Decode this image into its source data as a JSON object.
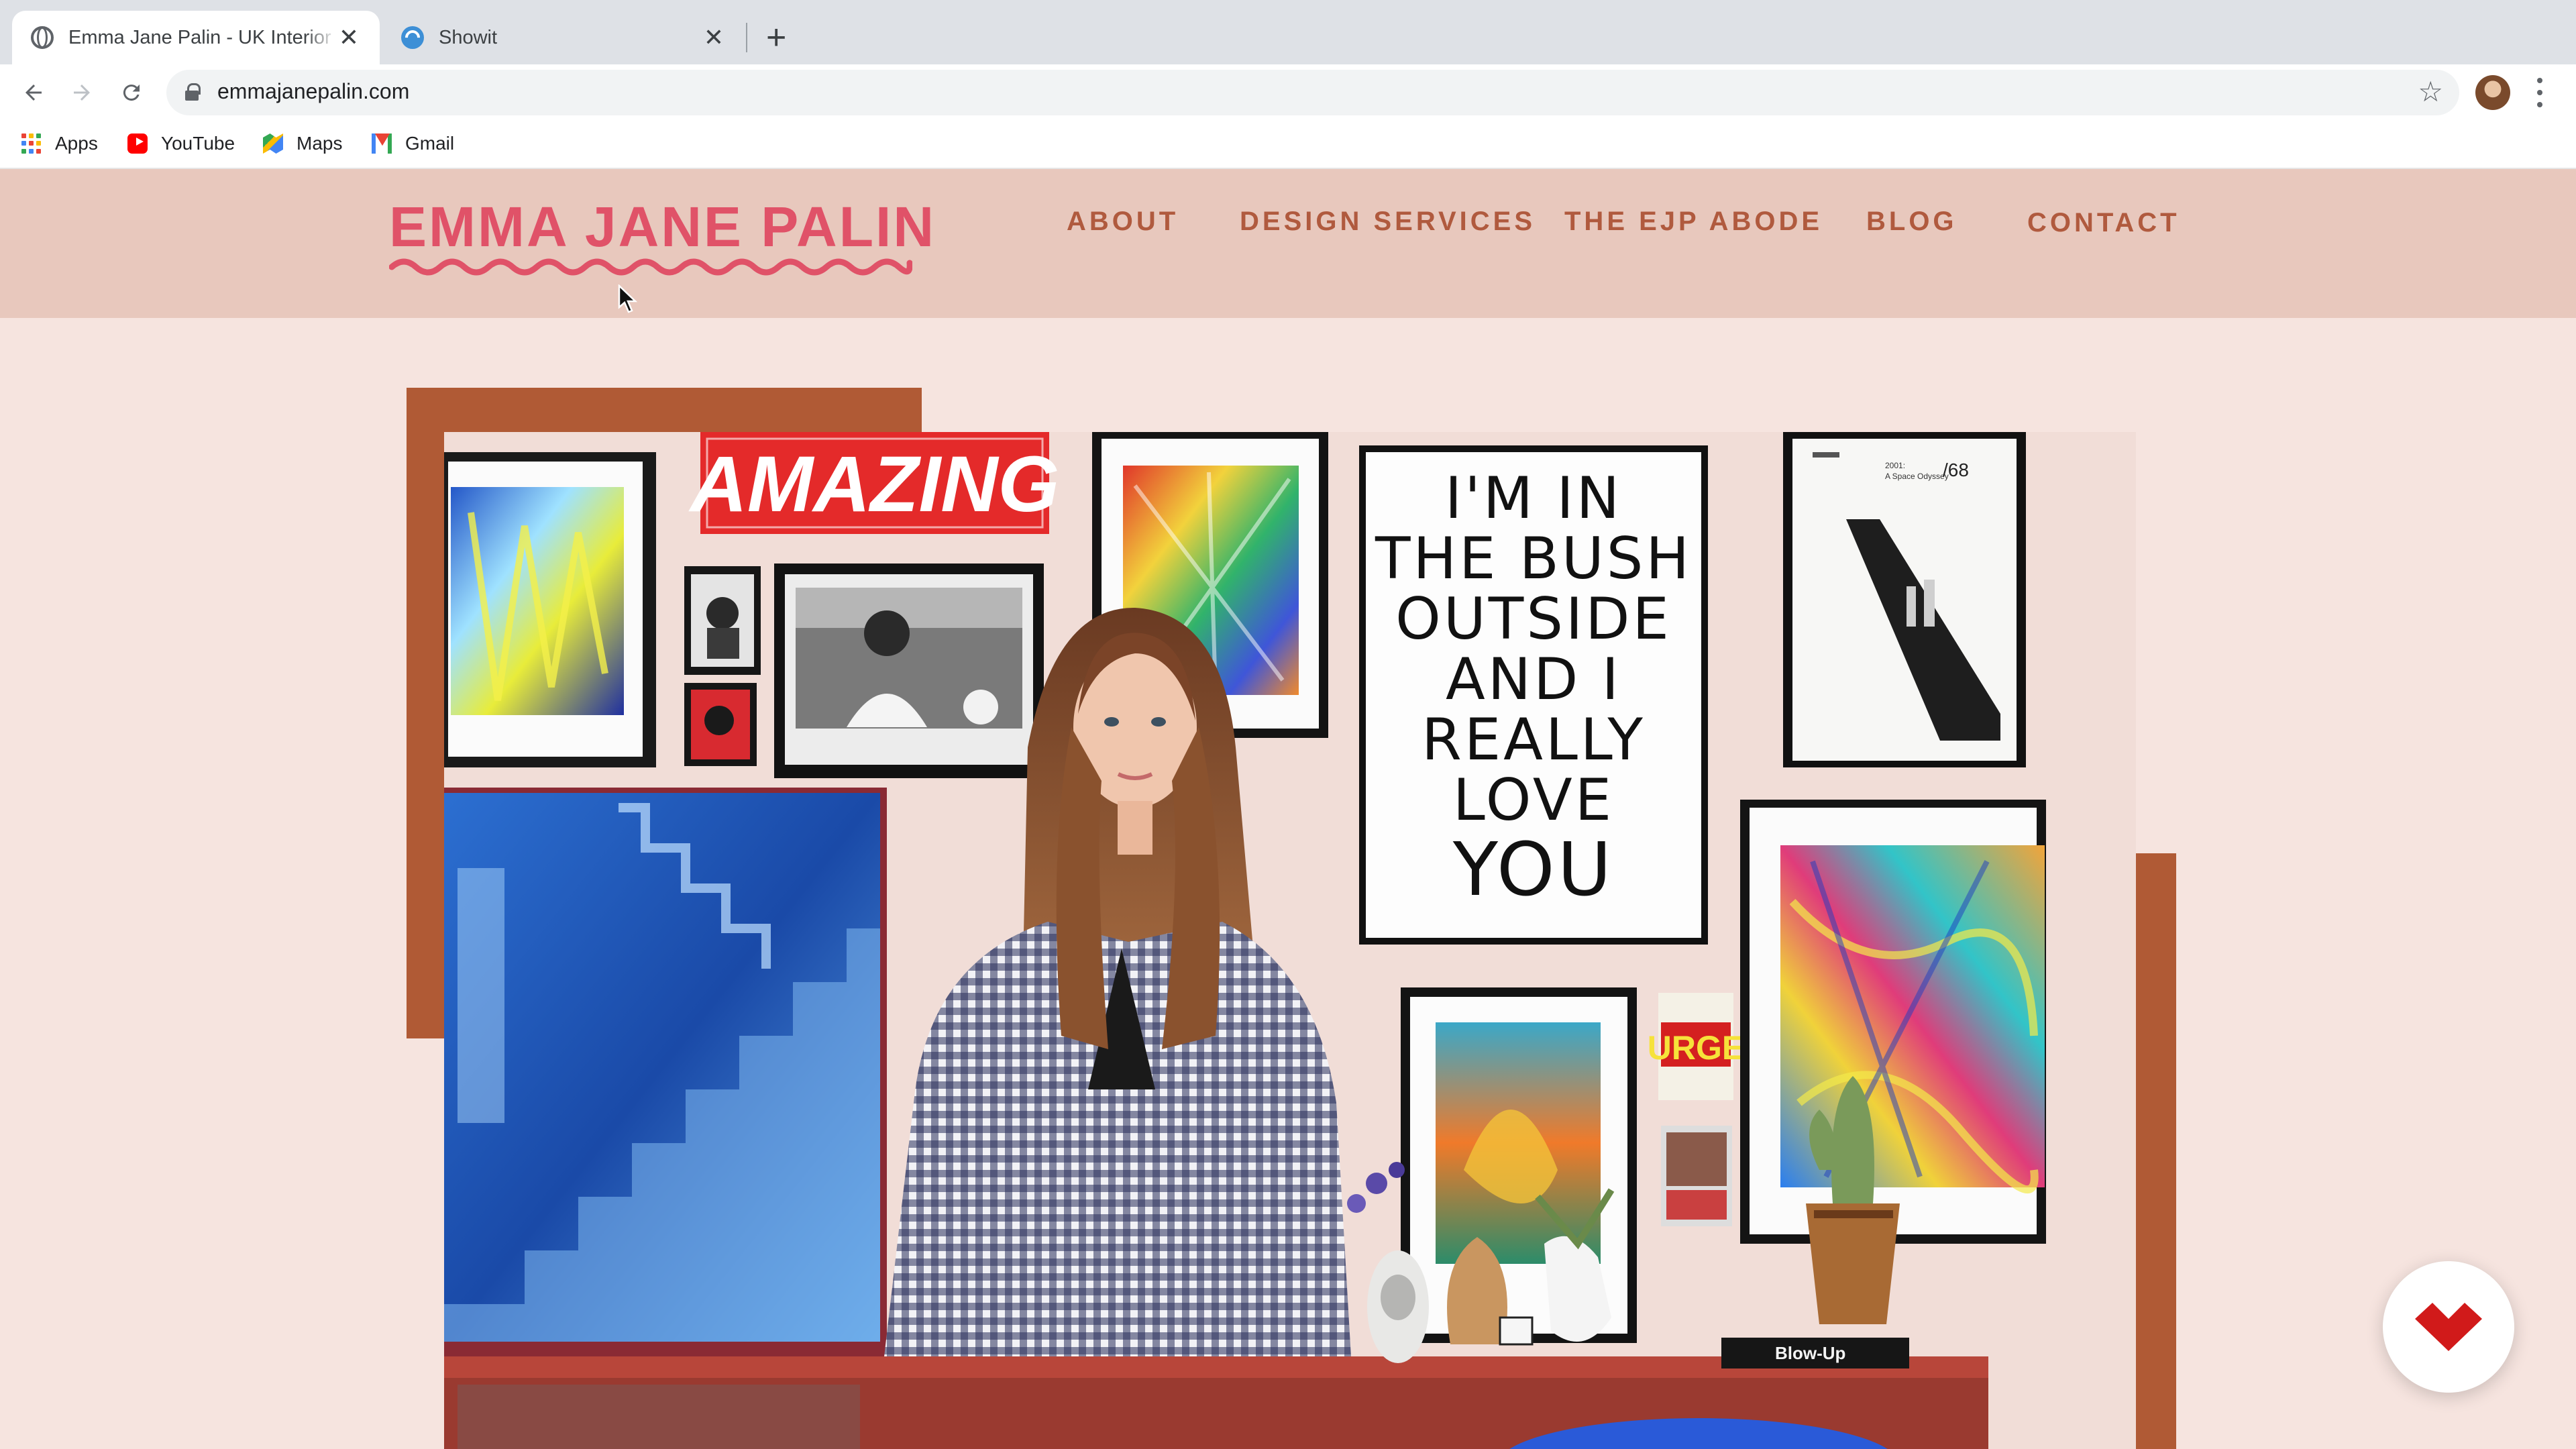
{
  "browser": {
    "tabs": [
      {
        "title": "Emma Jane Palin - UK Interior D",
        "favicon": "globe-icon",
        "active": true
      },
      {
        "title": "Showit",
        "favicon": "showit-icon",
        "active": false
      }
    ],
    "new_tab_label": "+",
    "close_glyph": "✕",
    "address": {
      "url": "emmajanepalin.com"
    },
    "bookmarks": [
      {
        "label": "Apps",
        "icon": "apps-grid-icon"
      },
      {
        "label": "YouTube",
        "icon": "youtube-icon"
      },
      {
        "label": "Maps",
        "icon": "maps-icon"
      },
      {
        "label": "Gmail",
        "icon": "gmail-icon"
      }
    ]
  },
  "site": {
    "logo": "EMMA JANE PALIN",
    "nav": [
      "ABOUT",
      "DESIGN SERVICES",
      "THE EJP ABODE",
      "BLOG",
      "CONTACT"
    ],
    "hero": {
      "sign_text": "AMAZING",
      "poster_lines": [
        "I'M IN",
        "THE BUSH",
        "OUTSIDE",
        "AND I",
        "REALLY",
        "LOVE",
        "YOU"
      ],
      "film_poster_num": "/68",
      "film_poster_title": "2001:",
      "film_poster_subtitle": "A Space Odyssey",
      "urge_sign": "URGE",
      "book_title": "Blow-Up"
    },
    "colors": {
      "page_bg": "#f6e4df",
      "header_bg": "#e8c8bd",
      "logo": "#e05268",
      "nav": "#b05a3e",
      "accent_block": "#b05a35",
      "badge_mark": "#d11a1a"
    }
  }
}
